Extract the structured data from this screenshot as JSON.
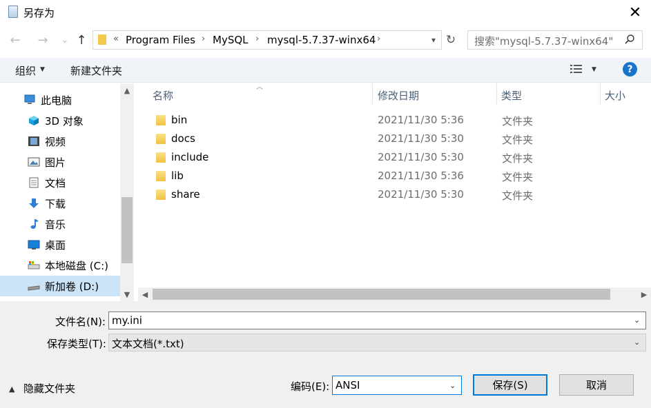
{
  "window": {
    "title": "另存为",
    "close_glyph": "✕"
  },
  "nav": {
    "back_glyph": "←",
    "forward_glyph": "→",
    "recent_glyph": "⌄",
    "up_glyph": "↑",
    "breadcrumb_prefix": "«",
    "breadcrumb": [
      "Program Files",
      "MySQL",
      "mysql-5.7.37-winx64"
    ],
    "refresh_glyph": "↻",
    "search_placeholder": "搜索\"mysql-5.7.37-winx64\""
  },
  "toolbar": {
    "organize": "组织",
    "new_folder": "新建文件夹",
    "help": "?"
  },
  "sidebar": {
    "items": [
      {
        "label": "此电脑",
        "icon": "pc-icon"
      },
      {
        "label": "3D 对象",
        "icon": "cube-icon"
      },
      {
        "label": "视频",
        "icon": "video-icon"
      },
      {
        "label": "图片",
        "icon": "picture-icon"
      },
      {
        "label": "文档",
        "icon": "document-icon"
      },
      {
        "label": "下载",
        "icon": "download-icon"
      },
      {
        "label": "音乐",
        "icon": "music-icon"
      },
      {
        "label": "桌面",
        "icon": "desktop-icon"
      },
      {
        "label": "本地磁盘 (C:)",
        "icon": "drive-icon"
      },
      {
        "label": "新加卷 (D:)",
        "icon": "drive-icon"
      }
    ],
    "selected_index": 9
  },
  "file_list": {
    "columns": [
      "名称",
      "修改日期",
      "类型",
      "大小"
    ],
    "rows": [
      {
        "name": "bin",
        "modified": "2021/11/30 5:36",
        "type": "文件夹"
      },
      {
        "name": "docs",
        "modified": "2021/11/30 5:30",
        "type": "文件夹"
      },
      {
        "name": "include",
        "modified": "2021/11/30 5:30",
        "type": "文件夹"
      },
      {
        "name": "lib",
        "modified": "2021/11/30 5:36",
        "type": "文件夹"
      },
      {
        "name": "share",
        "modified": "2021/11/30 5:30",
        "type": "文件夹"
      }
    ]
  },
  "form": {
    "filename_label": "文件名(N):",
    "filename_value": "my.ini",
    "filetype_label": "保存类型(T):",
    "filetype_value": "文本文档(*.txt)",
    "hide_folders": "隐藏文件夹",
    "encoding_label": "编码(E):",
    "encoding_value": "ANSI",
    "save": "保存(S)",
    "cancel": "取消"
  },
  "colors": {
    "accent": "#0078d7",
    "selected_bg": "#cce4f7",
    "folder": "#f1c242",
    "help_bg": "#1a73c8"
  }
}
